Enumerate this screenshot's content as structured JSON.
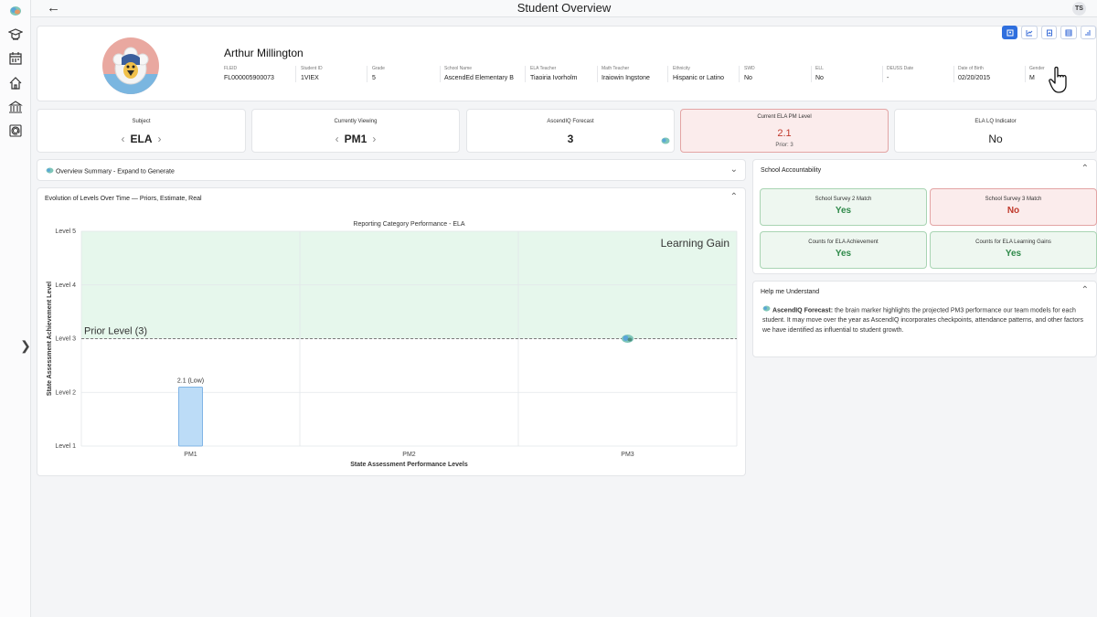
{
  "header": {
    "title": "Student Overview",
    "user_initials": "TS"
  },
  "sidebar": {
    "icons": [
      "brain-icon",
      "graduate-icon",
      "calendar-icon",
      "home-school-icon",
      "building-icon",
      "at-icon"
    ]
  },
  "student": {
    "name": "Arthur Millington",
    "fields": [
      {
        "label": "FLEID",
        "value": "FL000005900073"
      },
      {
        "label": "Student ID",
        "value": "1VIEX"
      },
      {
        "label": "Grade",
        "value": "5"
      },
      {
        "label": "School Name",
        "value": "AscendEd Elementary B"
      },
      {
        "label": "ELA Teacher",
        "value": "Tiaoiria Ivorholm"
      },
      {
        "label": "Math Teacher",
        "value": "Iraiowin Ingstone"
      },
      {
        "label": "Ethnicity",
        "value": "Hispanic or Latino"
      },
      {
        "label": "SWD",
        "value": "No"
      },
      {
        "label": "ELL",
        "value": "No"
      },
      {
        "label": "DEUSS Date",
        "value": "-"
      },
      {
        "label": "Date of Birth",
        "value": "02/20/2015"
      },
      {
        "label": "Gender",
        "value": "M"
      }
    ]
  },
  "stats": {
    "subject": {
      "label": "Subject",
      "value": "ELA"
    },
    "viewing": {
      "label": "Currently Viewing",
      "value": "PM1"
    },
    "forecast": {
      "label": "AscendIQ Forecast",
      "value": "3"
    },
    "pm_level": {
      "label": "Current ELA PM Level",
      "value": "2.1",
      "sub": "Prior: 3"
    },
    "lq": {
      "label": "ELA LQ Indicator",
      "value": "No"
    }
  },
  "overview": {
    "title": "Overview Summary - Expand to Generate"
  },
  "evolution": {
    "title": "Evolution of Levels Over Time — Priors, Estimate, Real"
  },
  "chart_data": {
    "type": "bar",
    "title": "Reporting Category Performance - ELA",
    "xlabel": "State Assessment Performance Levels",
    "ylabel": "State Assessment Achievement Level",
    "categories": [
      "PM1",
      "PM2",
      "PM3"
    ],
    "y_ticks": [
      "Level 1",
      "Level 2",
      "Level 3",
      "Level 4",
      "Level 5"
    ],
    "ylim": [
      1,
      5
    ],
    "bars": [
      {
        "category": "PM1",
        "value": 2.1,
        "label": "2.1 (Low)"
      }
    ],
    "prior_level": {
      "value": 3,
      "label": "Prior Level (3)"
    },
    "gain_band": {
      "from": 3,
      "to": 5,
      "label": "Learning Gain"
    },
    "forecast_marker": {
      "category": "PM3",
      "value": 3
    },
    "grid": true,
    "colors": {
      "bar": "#bcdcf7",
      "bar_border": "#6aa7e0",
      "gain_band": "#e6f7ec"
    }
  },
  "accountability": {
    "title": "School Accountability",
    "cards": [
      {
        "label": "School Survey 2 Match",
        "value": "Yes",
        "status": "good"
      },
      {
        "label": "School Survey 3 Match",
        "value": "No",
        "status": "bad"
      },
      {
        "label": "Counts for ELA Achievement",
        "value": "Yes",
        "status": "good"
      },
      {
        "label": "Counts for ELA Learning Gains",
        "value": "Yes",
        "status": "good"
      }
    ]
  },
  "help": {
    "title": "Help me Understand",
    "lead": "AscendIQ Forecast:",
    "text": " the brain marker highlights the projected PM3 performance our team models for each student. It may move over the year as AscendIQ incorporates checkpoints, attendance patterns, and other factors we have identified as influential to student growth."
  },
  "colors": {
    "accent": "#2f6fde",
    "good": "#2f8a4a",
    "bad": "#c0392b"
  }
}
